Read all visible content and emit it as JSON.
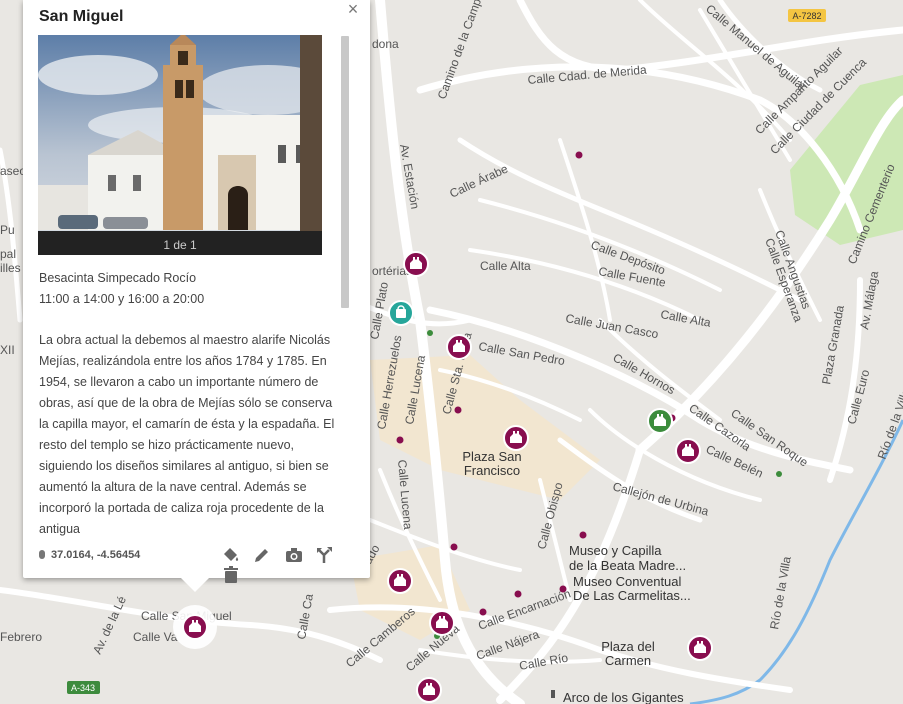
{
  "popup": {
    "title": "San Miguel",
    "close_glyph": "×",
    "photo_counter": "1 de 1",
    "info_line1": "Besacinta Simpecado Rocío",
    "info_line2": "11:00 a 14:00 y 16:00 a 20:00",
    "description": "La obra actual la debemos al maestro alarife Nicolás Mejías, realizándola entre los años 1784 y 1785. En 1954, se llevaron a cabo un importante número de obras, así que de la obra de Mejías sólo se conserva la capilla mayor, el camarín de ésta y la espadaña. El resto del templo se hizo prácticamente nuevo, siguiendo los diseños similares al antiguo, si bien se aumentó la altura de la nave central. Además se incorporó la portada de caliza roja procedente de la antigua",
    "coordinates": "37.0164, -4.56454",
    "tools": [
      "paint-bucket-icon",
      "pencil-icon",
      "camera-icon",
      "directions-icon",
      "trash-icon"
    ]
  },
  "map": {
    "road_badges": [
      "A-7282",
      "A-343"
    ],
    "streets": [
      "dona",
      "Camino de la Camp",
      "Calle Manuel de Aguilar",
      "Calle Amparito Aguilar",
      "Calle Ciudad de Cuenca",
      "Calle Cdad. de Merida",
      "Camino Cementerio",
      "Calle Árabe",
      "Av. Estación",
      "Calle Depósito",
      "Calle Esperanza",
      "Calle Angustias",
      "Calle Alta",
      "Calle Fuente",
      "Calle Alta",
      "Calle Juan Casco",
      "Calle San Pedro",
      "Calle Plato",
      "Calle Herrezuelos",
      "Calle Lucena",
      "Calle Sta. Clara",
      "Calle Hornos",
      "Plaza Granada",
      "Av. Málaga",
      "Calle Euro",
      "Calle Cazorla",
      "Calle San Roque",
      "Calle Belén",
      "Callejón de Urbina",
      "Calle Lucena",
      "Calle Obispo",
      "Río de la Villa",
      "Río de la Villa",
      "Calle San Miguel",
      "Calle Va",
      "Calle Camberos",
      "Calle Nueva",
      "Calle Encarnación",
      "Calle Nájera",
      "Calle Río",
      "Febrero",
      "Av. de la Lé",
      "ado",
      "Calle Ca",
      "aseo",
      "Pu",
      "pal",
      "illes",
      "XII",
      "ortérias"
    ],
    "places": [
      "Plaza San Francisco",
      "Museo y Capilla de la Beata Madre...",
      "Museo Conventual De Las Carmelitas...",
      "Plaza del Carmen",
      "Arco de los Gigantes"
    ],
    "place_lines": {
      "plaza_sf_1": "Plaza San",
      "plaza_sf_2": "Francisco",
      "museo1_1": "Museo y Capilla",
      "museo1_2": "de la Beata Madre...",
      "museo2_1": "Museo Conventual",
      "museo2_2": "De Las Carmelitas...",
      "carmen_1": "Plaza del",
      "carmen_2": "Carmen",
      "arco": "Arco de los Gigantes"
    },
    "colors": {
      "marker": "#880e4f",
      "marker_selected": "#2e7d32",
      "shop_marker": "#26a69a",
      "park": "#cde8b5",
      "water": "#7fb8e8",
      "road": "#ffffff",
      "map_bg": "#e9e7e3",
      "highlight_area": "#f2e6d0"
    }
  }
}
